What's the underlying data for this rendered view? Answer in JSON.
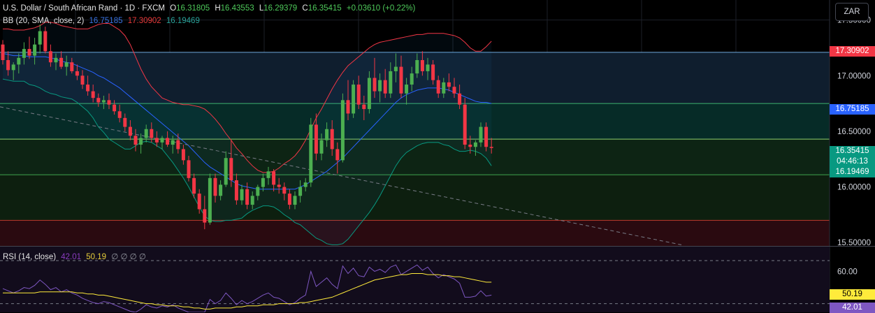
{
  "header": {
    "symbol": "U.S. Dollar / South African Rand · 1D · FXCM",
    "open_label": "O",
    "open": "16.31805",
    "high_label": "H",
    "high": "16.43553",
    "low_label": "L",
    "low": "16.29379",
    "close_label": "C",
    "close": "16.35415",
    "change": "+0.03610 (+0.22%)"
  },
  "bb": {
    "label": "BB (20, SMA, close, 2)",
    "basis": "16.75185",
    "upper": "17.30902",
    "lower": "16.19469"
  },
  "currency": "ZAR",
  "rsi": {
    "label": "RSI (14, close)",
    "value": "42.01",
    "ma": "50.19",
    "extras": "∅ ∅ ∅ ∅",
    "tick": "60.00"
  },
  "tags": {
    "upper": "17.30902",
    "basis": "16.75185",
    "price": "16.35415",
    "countdown": "04:46:13",
    "lower": "16.19469",
    "rsi_ma": "50.19",
    "rsi": "42.01"
  },
  "colors": {
    "up": "#4caf50",
    "down": "#f23645",
    "basis": "#2962ff",
    "upper": "#f23645",
    "lower": "#089981",
    "rsi": "#7e57c2",
    "rsi_ma": "#ffeb3b"
  },
  "chart_data": [
    {
      "type": "candlestick",
      "y_ticks": [
        "17.50000",
        "17.00000",
        "16.50000",
        "16.00000",
        "15.50000"
      ],
      "ylim": [
        15.47,
        17.68
      ],
      "horizontal_lines": [
        17.21,
        16.75,
        16.43,
        16.11,
        15.7
      ],
      "candles": [
        [
          17.28,
          17.32,
          17.1,
          17.14
        ],
        [
          17.14,
          17.22,
          17.0,
          17.05
        ],
        [
          17.05,
          17.12,
          16.96,
          17.1
        ],
        [
          17.1,
          17.2,
          17.02,
          17.16
        ],
        [
          17.16,
          17.3,
          17.1,
          17.24
        ],
        [
          17.24,
          17.35,
          17.15,
          17.18
        ],
        [
          17.18,
          17.34,
          17.1,
          17.28
        ],
        [
          17.28,
          17.46,
          17.2,
          17.4
        ],
        [
          17.4,
          17.44,
          17.2,
          17.22
        ],
        [
          17.22,
          17.28,
          17.08,
          17.12
        ],
        [
          17.12,
          17.2,
          17.05,
          17.16
        ],
        [
          17.16,
          17.22,
          17.06,
          17.08
        ],
        [
          17.08,
          17.18,
          17.0,
          17.12
        ],
        [
          17.12,
          17.16,
          17.02,
          17.04
        ],
        [
          17.04,
          17.1,
          16.96,
          17.0
        ],
        [
          17.0,
          17.05,
          16.88,
          16.92
        ],
        [
          16.92,
          17.0,
          16.82,
          16.86
        ],
        [
          16.86,
          16.92,
          16.76,
          16.8
        ],
        [
          16.8,
          16.84,
          16.72,
          16.76
        ],
        [
          16.76,
          16.82,
          16.7,
          16.78
        ],
        [
          16.78,
          16.84,
          16.7,
          16.74
        ],
        [
          16.74,
          16.78,
          16.65,
          16.68
        ],
        [
          16.68,
          16.74,
          16.58,
          16.62
        ],
        [
          16.62,
          16.66,
          16.5,
          16.54
        ],
        [
          16.54,
          16.6,
          16.42,
          16.46
        ],
        [
          16.46,
          16.52,
          16.32,
          16.38
        ],
        [
          16.38,
          16.48,
          16.3,
          16.44
        ],
        [
          16.44,
          16.56,
          16.4,
          16.52
        ],
        [
          16.52,
          16.58,
          16.4,
          16.44
        ],
        [
          16.44,
          16.5,
          16.36,
          16.4
        ],
        [
          16.4,
          16.46,
          16.34,
          16.44
        ],
        [
          16.44,
          16.5,
          16.36,
          16.38
        ],
        [
          16.38,
          16.46,
          16.3,
          16.42
        ],
        [
          16.42,
          16.48,
          16.3,
          16.34
        ],
        [
          16.34,
          16.38,
          16.2,
          16.24
        ],
        [
          16.24,
          16.28,
          16.05,
          16.08
        ],
        [
          16.08,
          16.12,
          15.9,
          15.94
        ],
        [
          15.94,
          15.98,
          15.76,
          15.8
        ],
        [
          15.8,
          15.92,
          15.62,
          15.68
        ],
        [
          15.68,
          16.12,
          15.66,
          16.08
        ],
        [
          16.08,
          16.12,
          15.86,
          15.92
        ],
        [
          15.92,
          16.06,
          15.88,
          16.02
        ],
        [
          16.02,
          16.32,
          16.0,
          16.26
        ],
        [
          16.26,
          16.42,
          16.0,
          16.06
        ],
        [
          16.06,
          16.12,
          15.84,
          15.88
        ],
        [
          15.88,
          16.02,
          15.84,
          15.98
        ],
        [
          15.98,
          16.04,
          15.8,
          15.84
        ],
        [
          15.84,
          15.96,
          15.8,
          15.92
        ],
        [
          15.92,
          16.02,
          15.88,
          16.0
        ],
        [
          16.0,
          16.12,
          15.96,
          16.08
        ],
        [
          16.08,
          16.18,
          16.02,
          16.14
        ],
        [
          16.14,
          16.16,
          15.96,
          16.02
        ],
        [
          16.02,
          16.08,
          15.94,
          16.0
        ],
        [
          16.0,
          16.04,
          15.88,
          15.94
        ],
        [
          15.94,
          15.98,
          15.8,
          15.84
        ],
        [
          15.84,
          15.96,
          15.8,
          15.92
        ],
        [
          15.92,
          16.06,
          15.86,
          16.0
        ],
        [
          16.0,
          16.08,
          15.96,
          16.04
        ],
        [
          16.04,
          16.62,
          16.0,
          16.56
        ],
        [
          16.56,
          16.66,
          16.24,
          16.3
        ],
        [
          16.3,
          16.48,
          16.24,
          16.42
        ],
        [
          16.42,
          16.58,
          16.36,
          16.52
        ],
        [
          16.52,
          16.6,
          16.28,
          16.34
        ],
        [
          16.34,
          16.4,
          16.12,
          16.24
        ],
        [
          16.24,
          16.84,
          16.22,
          16.78
        ],
        [
          16.78,
          16.96,
          16.6,
          16.66
        ],
        [
          16.66,
          16.96,
          16.62,
          16.92
        ],
        [
          16.92,
          17.0,
          16.7,
          16.74
        ],
        [
          16.74,
          16.82,
          16.6,
          16.7
        ],
        [
          16.7,
          17.04,
          16.66,
          16.98
        ],
        [
          16.98,
          17.16,
          16.8,
          16.86
        ],
        [
          16.86,
          17.02,
          16.76,
          16.96
        ],
        [
          16.96,
          17.06,
          16.8,
          16.84
        ],
        [
          16.84,
          17.12,
          16.8,
          17.04
        ],
        [
          17.04,
          17.2,
          16.94,
          17.08
        ],
        [
          17.08,
          17.18,
          16.8,
          16.84
        ],
        [
          16.84,
          16.98,
          16.74,
          16.92
        ],
        [
          16.92,
          17.08,
          16.86,
          17.02
        ],
        [
          17.02,
          17.2,
          16.98,
          17.14
        ],
        [
          17.14,
          17.22,
          17.0,
          17.04
        ],
        [
          17.04,
          17.16,
          16.96,
          17.1
        ],
        [
          17.1,
          17.14,
          16.92,
          16.96
        ],
        [
          16.96,
          17.0,
          16.8,
          16.84
        ],
        [
          16.84,
          16.98,
          16.8,
          16.94
        ],
        [
          16.94,
          17.02,
          16.86,
          16.9
        ],
        [
          16.9,
          16.98,
          16.8,
          16.84
        ],
        [
          16.84,
          16.92,
          16.7,
          16.74
        ],
        [
          16.74,
          16.8,
          16.34,
          16.38
        ],
        [
          16.38,
          16.46,
          16.3,
          16.36
        ],
        [
          16.36,
          16.42,
          16.28,
          16.4
        ],
        [
          16.4,
          16.58,
          16.36,
          16.54
        ],
        [
          16.54,
          16.58,
          16.32,
          16.36
        ],
        [
          16.36,
          16.44,
          16.3,
          16.35
        ]
      ],
      "bb_upper": [
        17.42,
        17.42,
        17.41,
        17.41,
        17.41,
        17.42,
        17.43,
        17.45,
        17.48,
        17.48,
        17.47,
        17.45,
        17.44,
        17.43,
        17.42,
        17.42,
        17.42,
        17.44,
        17.46,
        17.47,
        17.47,
        17.44,
        17.41,
        17.36,
        17.28,
        17.17,
        17.06,
        16.97,
        16.9,
        16.85,
        16.8,
        16.78,
        16.76,
        16.75,
        16.74,
        16.74,
        16.73,
        16.72,
        16.7,
        16.66,
        16.61,
        16.55,
        16.48,
        16.42,
        16.35,
        16.3,
        16.24,
        16.19,
        16.15,
        16.13,
        16.13,
        16.14,
        16.17,
        16.21,
        16.24,
        16.28,
        16.34,
        16.42,
        16.52,
        16.62,
        16.7,
        16.79,
        16.88,
        16.96,
        17.03,
        17.09,
        17.13,
        17.17,
        17.21,
        17.25,
        17.28,
        17.3,
        17.31,
        17.32,
        17.33,
        17.34,
        17.35,
        17.36,
        17.37,
        17.37,
        17.38,
        17.38,
        17.38,
        17.38,
        17.37,
        17.36,
        17.34,
        17.3,
        17.25,
        17.22,
        17.22,
        17.26,
        17.31
      ],
      "bb_basis": [
        17.2,
        17.19,
        17.18,
        17.18,
        17.18,
        17.17,
        17.17,
        17.17,
        17.17,
        17.16,
        17.15,
        17.13,
        17.12,
        17.11,
        17.09,
        17.07,
        17.05,
        17.03,
        17.0,
        16.98,
        16.95,
        16.92,
        16.89,
        16.85,
        16.81,
        16.77,
        16.73,
        16.69,
        16.65,
        16.61,
        16.57,
        16.53,
        16.49,
        16.45,
        16.41,
        16.37,
        16.32,
        16.27,
        16.22,
        16.18,
        16.15,
        16.12,
        16.09,
        16.06,
        16.03,
        16.01,
        16.0,
        15.99,
        15.98,
        15.98,
        15.98,
        15.98,
        15.98,
        15.98,
        15.98,
        15.98,
        16.0,
        16.02,
        16.05,
        16.08,
        16.11,
        16.14,
        16.18,
        16.22,
        16.26,
        16.31,
        16.36,
        16.41,
        16.46,
        16.51,
        16.56,
        16.61,
        16.66,
        16.71,
        16.76,
        16.8,
        16.83,
        16.85,
        16.87,
        16.88,
        16.89,
        16.89,
        16.89,
        16.88,
        16.87,
        16.85,
        16.83,
        16.81,
        16.79,
        16.77,
        16.76,
        16.76,
        16.75
      ],
      "bb_lower": [
        16.97,
        16.96,
        16.95,
        16.95,
        16.95,
        16.92,
        16.91,
        16.89,
        16.86,
        16.84,
        16.83,
        16.81,
        16.8,
        16.79,
        16.76,
        16.72,
        16.68,
        16.62,
        16.54,
        16.49,
        16.43,
        16.4,
        16.37,
        16.34,
        16.34,
        16.37,
        16.4,
        16.41,
        16.4,
        16.37,
        16.34,
        16.28,
        16.22,
        16.15,
        16.08,
        16.0,
        15.91,
        15.82,
        15.74,
        15.7,
        15.69,
        15.69,
        15.7,
        15.7,
        15.71,
        15.72,
        15.76,
        15.79,
        15.81,
        15.83,
        15.83,
        15.82,
        15.79,
        15.75,
        15.72,
        15.68,
        15.66,
        15.62,
        15.58,
        15.54,
        15.52,
        15.49,
        15.48,
        15.48,
        15.49,
        15.53,
        15.59,
        15.65,
        15.71,
        15.77,
        15.84,
        15.92,
        16.01,
        16.1,
        16.19,
        16.26,
        16.31,
        16.34,
        16.37,
        16.39,
        16.4,
        16.4,
        16.4,
        16.38,
        16.37,
        16.34,
        16.32,
        16.32,
        16.33,
        16.32,
        16.3,
        16.26,
        16.19
      ]
    },
    {
      "type": "line",
      "title": "RSI (14, close)",
      "ylim": [
        22,
        83
      ],
      "y_ticks": [
        "60.00"
      ],
      "reference_lines": [
        70,
        30
      ],
      "series": [
        {
          "name": "RSI",
          "values": [
            44,
            42,
            40,
            42,
            45,
            44,
            47,
            52,
            48,
            43,
            45,
            41,
            43,
            40,
            38,
            35,
            33,
            31,
            30,
            32,
            31,
            29,
            27,
            25,
            23,
            22,
            25,
            29,
            27,
            26,
            28,
            27,
            29,
            26,
            24,
            22,
            22,
            22,
            22,
            34,
            30,
            33,
            40,
            35,
            29,
            33,
            30,
            32,
            35,
            38,
            40,
            36,
            35,
            32,
            29,
            31,
            35,
            38,
            60,
            46,
            50,
            54,
            48,
            44,
            65,
            58,
            63,
            56,
            55,
            64,
            60,
            62,
            59,
            64,
            66,
            57,
            60,
            63,
            66,
            61,
            64,
            58,
            54,
            57,
            55,
            53,
            49,
            36,
            36,
            37,
            42,
            37,
            38
          ]
        },
        {
          "name": "MA",
          "values": [
            40,
            40,
            40,
            40,
            40,
            40,
            40,
            41,
            41,
            41,
            41,
            41,
            41,
            41,
            40,
            40,
            39,
            39,
            38,
            38,
            37,
            36,
            35,
            34,
            33,
            32,
            31,
            30,
            30,
            29,
            29,
            28,
            28,
            28,
            27,
            27,
            26,
            26,
            25,
            25,
            26,
            26,
            26,
            26,
            27,
            27,
            28,
            28,
            28,
            29,
            29,
            29,
            30,
            30,
            30,
            30,
            31,
            31,
            32,
            33,
            34,
            35,
            36,
            38,
            40,
            42,
            44,
            46,
            48,
            50,
            52,
            53,
            54,
            55,
            56,
            57,
            57,
            58,
            58,
            58,
            57,
            57,
            57,
            56,
            56,
            55,
            55,
            54,
            53,
            52,
            51,
            50,
            50
          ]
        }
      ]
    }
  ]
}
